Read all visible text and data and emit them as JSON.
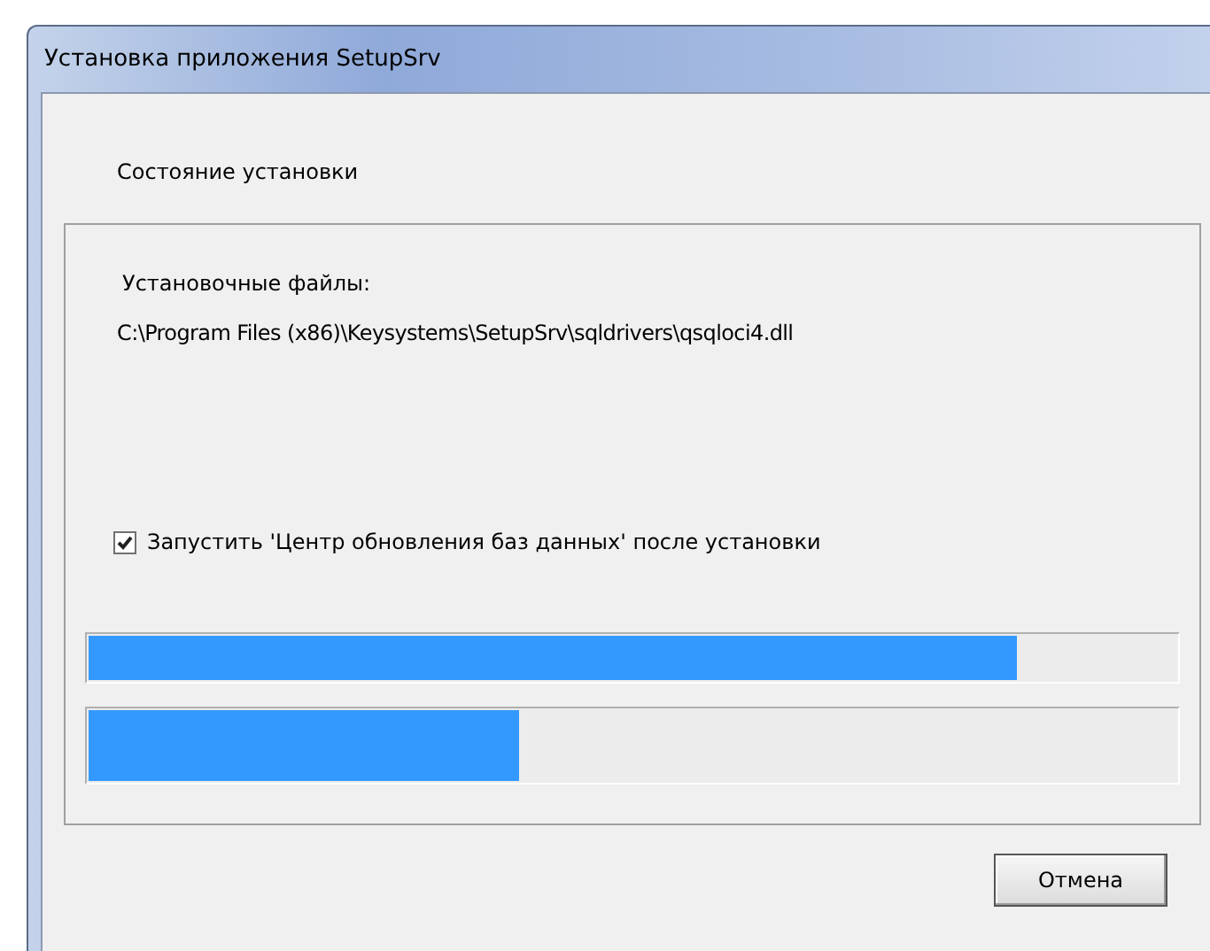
{
  "window": {
    "title": "Установка приложения SetupSrv"
  },
  "heading": "Состояние установки",
  "files_label": "Установочные файлы:",
  "current_file": "C:\\Program Files (x86)\\Keysystems\\SetupSrv\\sqldrivers\\qsqloci4.dll",
  "launch_checkbox": {
    "label": "Запустить 'Центр обновления баз данных' после установки",
    "checked": true
  },
  "progress_bars": [
    {
      "level": 0.853
    },
    {
      "level": 0.396
    }
  ],
  "buttons": [
    "Отмена"
  ]
}
